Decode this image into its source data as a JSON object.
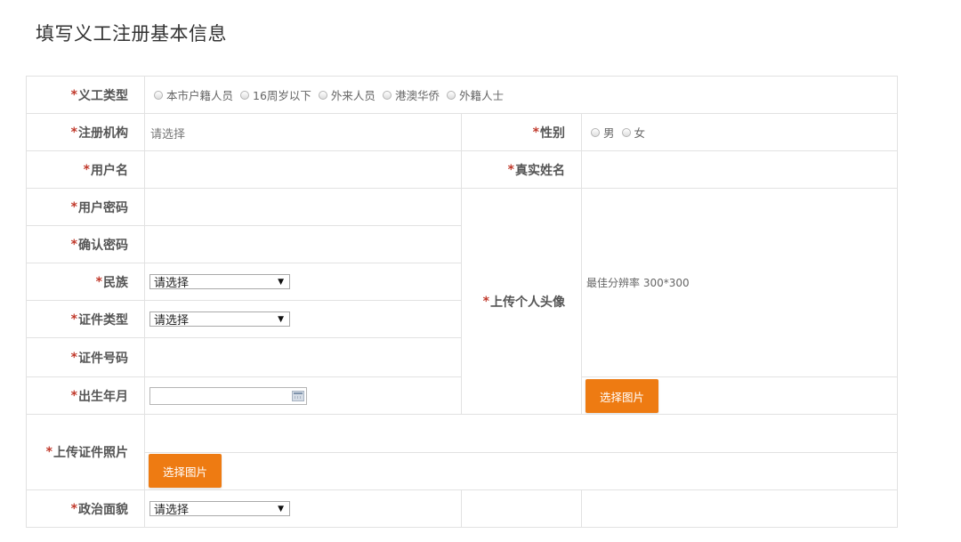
{
  "page": {
    "title": "填写义工注册基本信息"
  },
  "required_mark": "*",
  "form": {
    "volunteer_type": {
      "label": "义工类型",
      "options": [
        "本市户籍人员",
        "16周岁以下",
        "外来人员",
        "港澳华侨",
        "外籍人士"
      ]
    },
    "institution": {
      "label": "注册机构",
      "value": "请选择"
    },
    "gender": {
      "label": "性别",
      "options": [
        "男",
        "女"
      ]
    },
    "username": {
      "label": "用户名",
      "value": ""
    },
    "real_name": {
      "label": "真实姓名",
      "value": ""
    },
    "password": {
      "label": "用户密码",
      "value": ""
    },
    "confirm_password": {
      "label": "确认密码",
      "value": ""
    },
    "ethnicity": {
      "label": "民族",
      "selected": "请选择"
    },
    "id_type": {
      "label": "证件类型",
      "selected": "请选择"
    },
    "id_number": {
      "label": "证件号码",
      "value": ""
    },
    "birth_date": {
      "label": "出生年月",
      "value": ""
    },
    "avatar": {
      "label": "上传个人头像",
      "hint": "最佳分辨率 300*300",
      "button": "选择图片"
    },
    "id_photo": {
      "label": "上传证件照片",
      "button": "选择图片"
    },
    "political_status": {
      "label": "政治面貌",
      "selected": "请选择"
    }
  },
  "colors": {
    "accent": "#ee7b12",
    "required": "#c0392b",
    "border": "#e2e2e2"
  },
  "icons": {
    "calendar": "calendar-icon",
    "dropdown": "chevron-down-icon",
    "radio": "radio-icon"
  }
}
